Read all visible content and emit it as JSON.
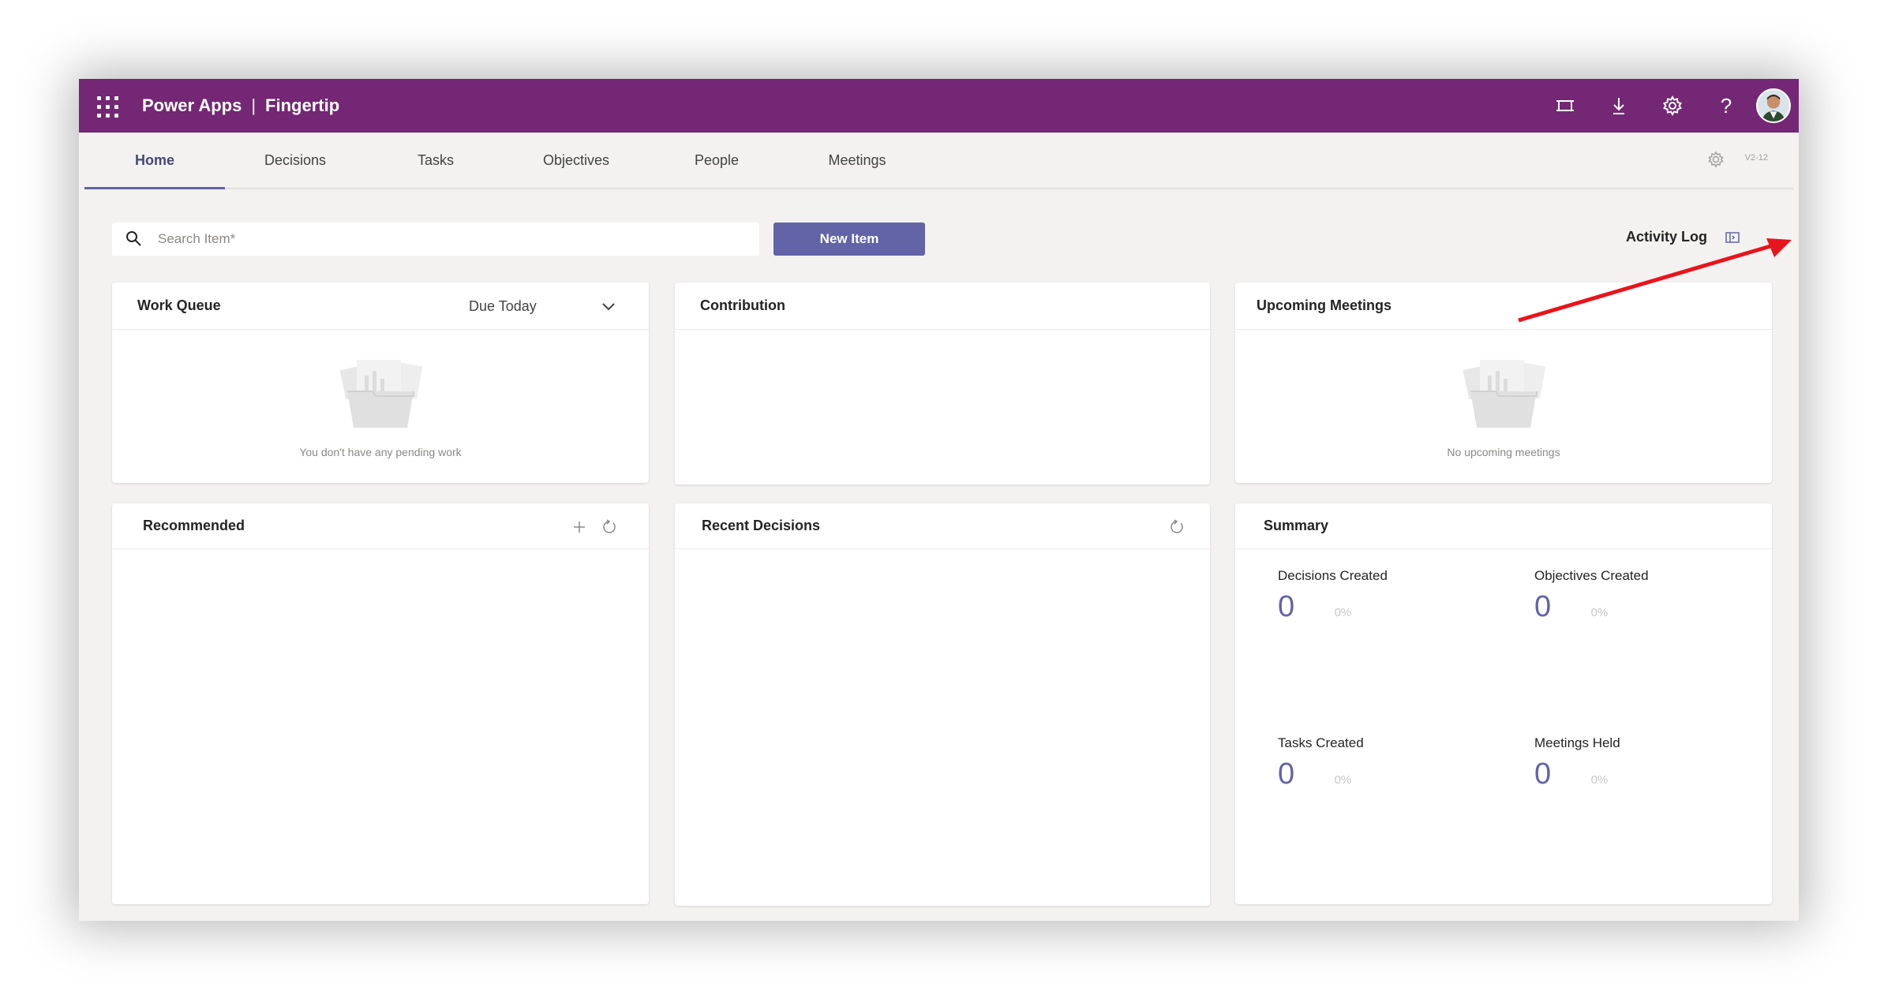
{
  "app": {
    "brand_left": "Power Apps",
    "brand_sep": "|",
    "brand_right": "Fingertip",
    "accent_color": "#742774",
    "primary_color": "#6264a7"
  },
  "topbar_icons": [
    "fit-screen-icon",
    "download-icon",
    "settings-icon",
    "help-icon",
    "avatar"
  ],
  "help_glyph": "?",
  "tabs": [
    {
      "label": "Home",
      "active": true
    },
    {
      "label": "Decisions"
    },
    {
      "label": "Tasks"
    },
    {
      "label": "Objectives"
    },
    {
      "label": "People"
    },
    {
      "label": "Meetings"
    }
  ],
  "version": "V2-12",
  "search": {
    "placeholder": "Search Item*"
  },
  "new_item_label": "New Item",
  "activity_log_label": "Activity Log",
  "work_queue": {
    "title": "Work Queue",
    "filter_value": "Due Today",
    "empty_text": "You don't have any pending work"
  },
  "contribution": {
    "title": "Contribution"
  },
  "upcoming_meetings": {
    "title": "Upcoming Meetings",
    "empty_text": "No upcoming meetings"
  },
  "recommended": {
    "title": "Recommended"
  },
  "recent_decisions": {
    "title": "Recent Decisions"
  },
  "summary": {
    "title": "Summary",
    "stats": [
      {
        "label": "Decisions Created",
        "value": "0",
        "percent": "0%"
      },
      {
        "label": "Objectives Created",
        "value": "0",
        "percent": "0%"
      },
      {
        "label": "Tasks Created",
        "value": "0",
        "percent": "0%"
      },
      {
        "label": "Meetings Held",
        "value": "0",
        "percent": "0%"
      }
    ]
  }
}
